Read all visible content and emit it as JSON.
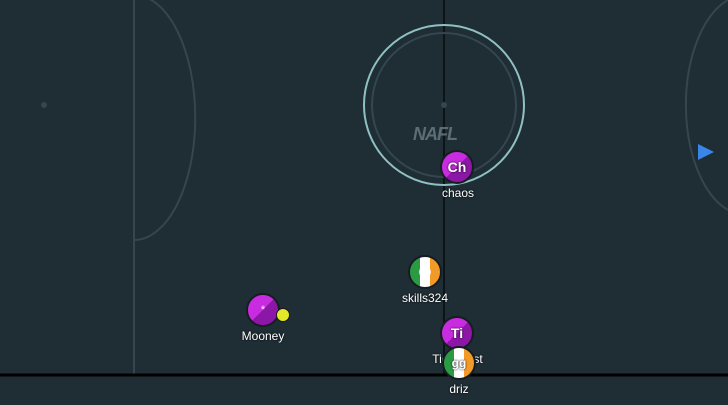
{
  "field": {
    "logo_text": "NAFL",
    "colors": {
      "pitch": "#1f2d35",
      "line": "#34464f",
      "center_ring": "#8fc0c3",
      "goal_line": "#000000"
    }
  },
  "players": [
    {
      "id": "chaos",
      "name": "chaos",
      "badge": "Ch",
      "style": "purple"
    },
    {
      "id": "skills324",
      "name": "skills324",
      "badge": "",
      "style": "ireland"
    },
    {
      "id": "mooney",
      "name": "Mooney",
      "badge": "*",
      "style": "purple"
    },
    {
      "id": "ti",
      "name": "Tic",
      "name_suffix": "st",
      "badge": "Ti",
      "style": "purple"
    },
    {
      "id": "driz",
      "name": "driz",
      "badge": "gg",
      "style": "ireland"
    }
  ],
  "ball": {
    "carrier": "Mooney",
    "color": "#e3e82a"
  },
  "goal_marker": {
    "color": "#3a86e8",
    "icon": "triangle-right-icon"
  }
}
